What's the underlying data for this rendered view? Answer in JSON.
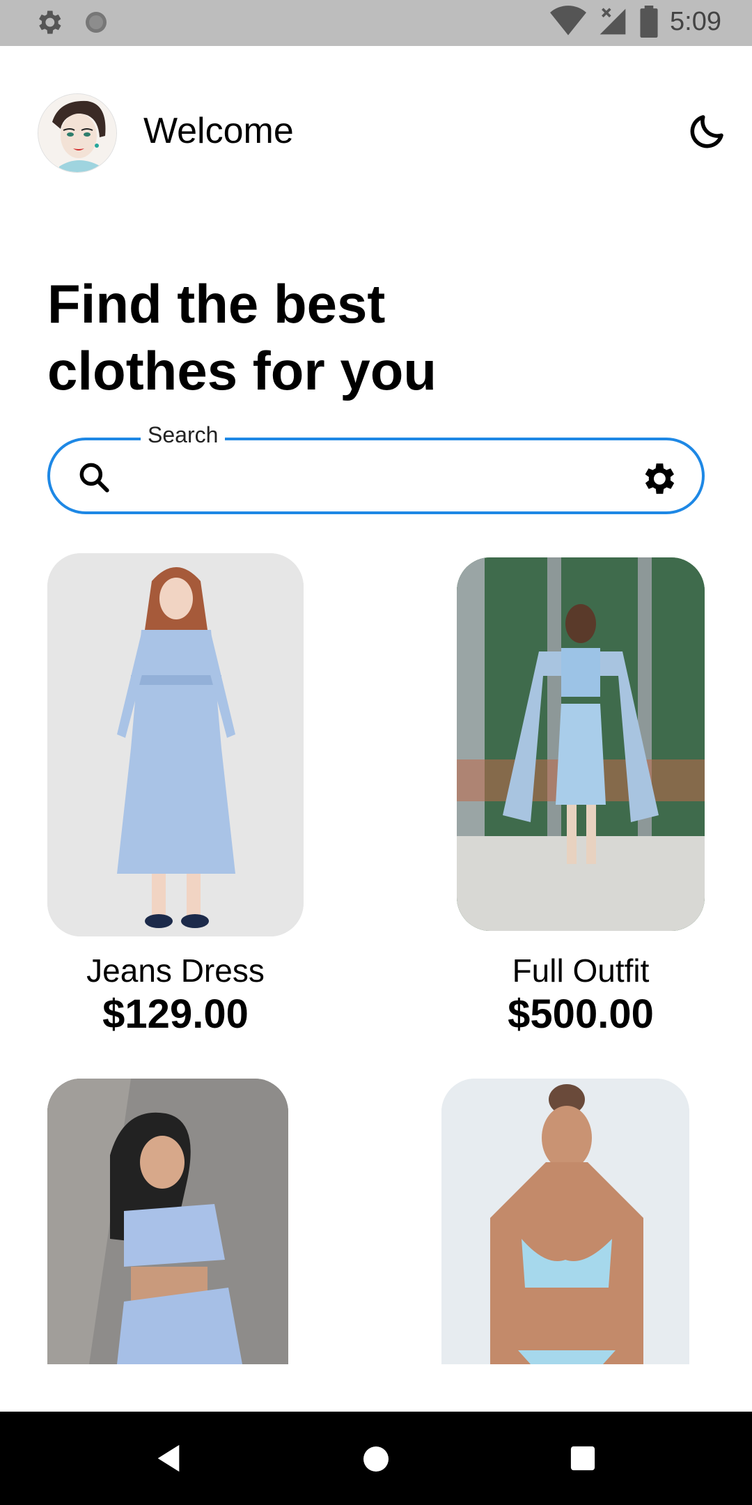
{
  "status_bar": {
    "time": "5:09",
    "icons": [
      "settings-icon",
      "circle-icon",
      "wifi-icon",
      "signal-icon",
      "battery-icon"
    ]
  },
  "header": {
    "welcome_text": "Welcome",
    "theme_icon": "moon-icon"
  },
  "headline": {
    "line1": "Find the best",
    "line2": "clothes for you"
  },
  "search": {
    "label": "Search",
    "value": "",
    "placeholder": "",
    "accent_color": "#1e88e5"
  },
  "products": [
    {
      "name": "Jeans Dress",
      "price": "$129.00"
    },
    {
      "name": "Full Outfit",
      "price": "$500.00"
    },
    {
      "name": "",
      "price": ""
    },
    {
      "name": "",
      "price": ""
    }
  ],
  "nav_bar": {
    "icons": [
      "back-icon",
      "home-icon",
      "recents-icon"
    ]
  }
}
